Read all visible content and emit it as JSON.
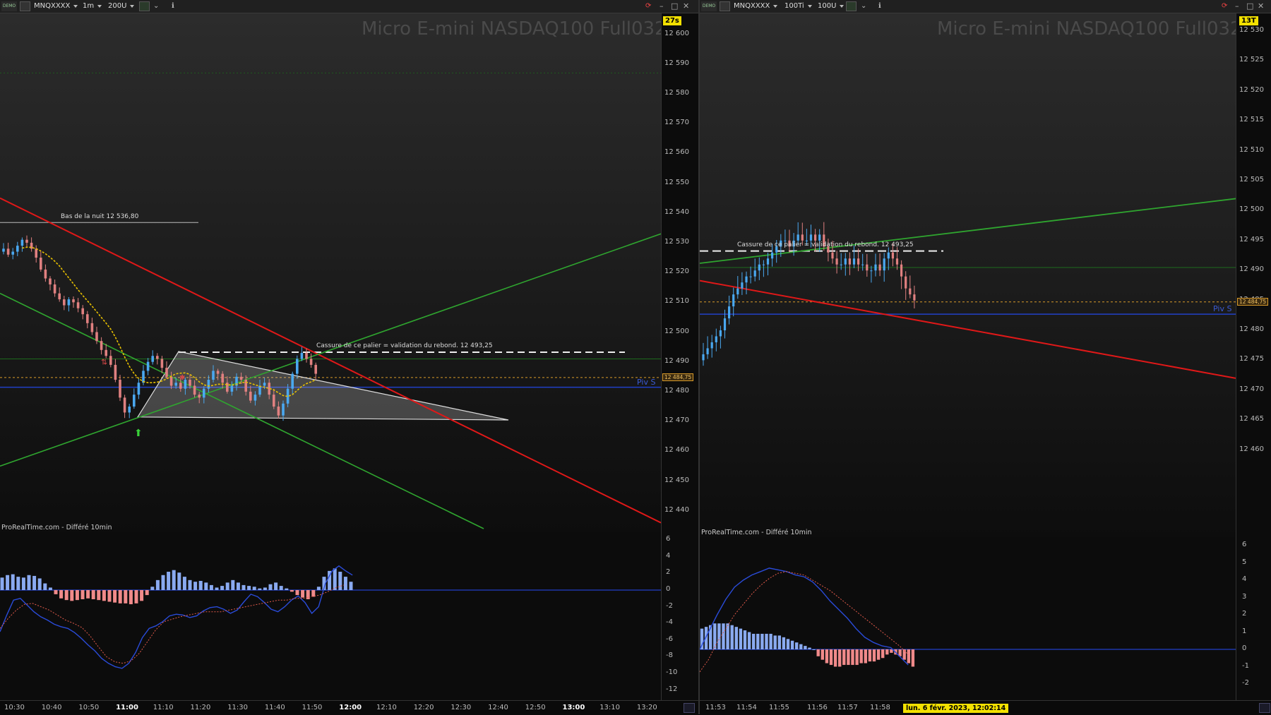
{
  "left": {
    "toolbar": {
      "instrument": "MNQXXXX",
      "period": "1m",
      "units": "200U"
    },
    "countdown": "27s",
    "title": "Micro E-mini NASDAQ100 Full0323",
    "source": "ProRealTime.com - Différé 10min",
    "annotations": {
      "night_low": "Bas de la nuit 12 536,80",
      "breakout": "Cassure de ce palier = validation du rebond. 12 493,25",
      "piv": "Piv S",
      "last_price": "12 484,75"
    },
    "x_labels": [
      {
        "t": "10:30",
        "b": false
      },
      {
        "t": "10:40",
        "b": false
      },
      {
        "t": "10:50",
        "b": false
      },
      {
        "t": "11:00",
        "b": true
      },
      {
        "t": "11:10",
        "b": false
      },
      {
        "t": "11:20",
        "b": false
      },
      {
        "t": "11:30",
        "b": false
      },
      {
        "t": "11:40",
        "b": false
      },
      {
        "t": "11:50",
        "b": false
      },
      {
        "t": "12:00",
        "b": true
      },
      {
        "t": "12:10",
        "b": false
      },
      {
        "t": "12:20",
        "b": false
      },
      {
        "t": "12:30",
        "b": false
      },
      {
        "t": "12:40",
        "b": false
      },
      {
        "t": "12:50",
        "b": false
      },
      {
        "t": "13:00",
        "b": true
      },
      {
        "t": "13:10",
        "b": false
      },
      {
        "t": "13:20",
        "b": false
      }
    ],
    "price_labels": [
      "12 600",
      "12 590",
      "12 580",
      "12 570",
      "12 560",
      "12 550",
      "12 540",
      "12 530",
      "12 520",
      "12 510",
      "12 500",
      "12 490",
      "12 480",
      "12 470",
      "12 460",
      "12 450",
      "12 440"
    ],
    "ind_labels": [
      "6",
      "4",
      "2",
      "0",
      "-2",
      "-4",
      "-6",
      "-8",
      "-10",
      "-12"
    ]
  },
  "right": {
    "toolbar": {
      "instrument": "MNQXXXX",
      "period": "100Ti",
      "units": "100U"
    },
    "countdown": "13T",
    "title": "Micro E-mini NASDAQ100 Full0323",
    "source": "ProRealTime.com - Différé 10min",
    "annotations": {
      "breakout": "Cassure de ce palier = validation du rebond. 12 493,25",
      "piv": "Piv S",
      "last_price": "12 484,75"
    },
    "x_labels": [
      {
        "t": "11:53",
        "b": false
      },
      {
        "t": "11:54",
        "b": false
      },
      {
        "t": "11:55",
        "b": false
      },
      {
        "t": "11:56",
        "b": false
      },
      {
        "t": "11:57",
        "b": false
      },
      {
        "t": "11:58",
        "b": false
      },
      {
        "t": "12:00",
        "b": true
      }
    ],
    "date_tag": "lun. 6 févr. 2023, 12:02:14",
    "price_labels": [
      "12 530",
      "12 525",
      "12 520",
      "12 515",
      "12 510",
      "12 505",
      "12 500",
      "12 495",
      "12 490",
      "12 485",
      "12 480",
      "12 475",
      "12 470",
      "12 465",
      "12 460"
    ],
    "ind_labels": [
      "6",
      "5",
      "4",
      "3",
      "2",
      "1",
      "0",
      "-1",
      "-2"
    ]
  },
  "colors": {
    "up": "#4aa8f0",
    "down": "#e08080",
    "sma": "#e8c000",
    "green": "#2fa52f",
    "red": "#e01818",
    "blue": "#2140c8",
    "hist_up": "#8aaaf0",
    "hist_down": "#f08a8a"
  },
  "chart_data": [
    {
      "type": "candlestick",
      "title": "Micro E-mini NASDAQ100 Full0323",
      "timeframe": "1m",
      "ylim": [
        12435,
        12605
      ],
      "time_range": [
        "10:24",
        "13:24"
      ],
      "close": [
        12528,
        12526,
        12527,
        12529,
        12531,
        12530,
        12528,
        12525,
        12521,
        12518,
        12516,
        12513,
        12511,
        12509,
        12511,
        12510,
        12508,
        12506,
        12503,
        12500,
        12497,
        12494,
        12492,
        12489,
        12484,
        12478,
        12473,
        12475,
        12479,
        12483,
        12487,
        12490,
        12492,
        12491,
        12488,
        12485,
        12482,
        12483,
        12481,
        12484,
        12482,
        12479,
        12478,
        12481,
        12484,
        12487,
        12486,
        12483,
        12480,
        12482,
        12485,
        12484,
        12480,
        12477,
        12479,
        12482,
        12483,
        12479,
        12475,
        12472,
        12476,
        12481,
        12486,
        12491,
        12493,
        12491,
        12489,
        12486
      ],
      "levels": {
        "night_low": 12536.8,
        "breakout": 12493.25,
        "piv_s": 12481.5,
        "last": 12484.75,
        "green_h": 12491
      },
      "indicator": {
        "name": "MACD histogram",
        "ylim": [
          -13,
          7
        ],
        "histogram": [
          1.5,
          1.8,
          1.9,
          1.6,
          1.5,
          1.8,
          1.7,
          1.4,
          0.8,
          0.3,
          -0.5,
          -1,
          -1.2,
          -1.3,
          -1.2,
          -1.1,
          -1,
          -1.1,
          -1.2,
          -1.3,
          -1.4,
          -1.5,
          -1.6,
          -1.6,
          -1.7,
          -1.6,
          -1.3,
          -0.6,
          0.4,
          1.2,
          1.8,
          2.2,
          2.4,
          2.1,
          1.6,
          1.2,
          1,
          1.1,
          0.9,
          0.6,
          0.3,
          0.5,
          0.9,
          1.2,
          0.9,
          0.6,
          0.5,
          0.4,
          0.2,
          0.3,
          0.7,
          0.9,
          0.5,
          0.2,
          -0.2,
          -0.6,
          -0.9,
          -1.1,
          -0.8,
          0.4,
          1.6,
          2.3,
          2.6,
          2.2,
          1.6,
          1.0
        ],
        "macd": [
          -5,
          -3,
          -1.2,
          -1,
          -1.8,
          -2.6,
          -3.2,
          -3.6,
          -4.1,
          -4.4,
          -4.6,
          -5.1,
          -5.8,
          -6.6,
          -7.3,
          -8.2,
          -8.8,
          -9.2,
          -9.4,
          -8.8,
          -7.5,
          -5.7,
          -4.6,
          -4.3,
          -3.8,
          -3.1,
          -2.9,
          -3,
          -3.3,
          -3.1,
          -2.5,
          -2.1,
          -2,
          -2.3,
          -2.8,
          -2.4,
          -1.4,
          -0.5,
          -0.8,
          -1.5,
          -2.3,
          -2.6,
          -2,
          -1.2,
          -0.7,
          -1.5,
          -2.8,
          -2,
          0.8,
          2.3,
          2.9,
          2.3,
          1.8
        ],
        "signal": [
          -4.6,
          -3.4,
          -2.4,
          -1.7,
          -1.6,
          -2,
          -2.4,
          -3,
          -3.6,
          -4,
          -4.5,
          -5.5,
          -6.8,
          -8,
          -8.6,
          -8.8,
          -8.5,
          -7.6,
          -6.2,
          -4.8,
          -3.8,
          -3.5,
          -3.2,
          -3,
          -2.8,
          -2.6,
          -2.6,
          -2.6,
          -2.4,
          -2.2,
          -2,
          -1.8,
          -1.6,
          -1.4,
          -1.2,
          -1.2,
          -1,
          -1,
          -0.8,
          -0.6,
          -0.2,
          0.3,
          0.6
        ]
      }
    },
    {
      "type": "candlestick",
      "title": "Micro E-mini NASDAQ100 Full0323",
      "timeframe": "100 ticks",
      "ylim": [
        12455,
        12532
      ],
      "time_range": [
        "11:52:40",
        "12:02:14"
      ],
      "close": [
        12476,
        12477,
        12478,
        12479,
        12480,
        12482,
        12484,
        12486,
        12487,
        12488,
        12489,
        12489,
        12490,
        12491,
        12491,
        12492,
        12493,
        12494,
        12495,
        12495,
        12494,
        12495,
        12496,
        12495,
        12495,
        12496,
        12495,
        12496,
        12494,
        12493,
        12492,
        12491,
        12491,
        12492,
        12491,
        12492,
        12491,
        12491,
        12490,
        12490,
        12491,
        12490,
        12492,
        12493,
        12492,
        12491,
        12489,
        12487,
        12486,
        12485
      ],
      "levels": {
        "breakout": 12493.25,
        "piv_s": 12482.7,
        "last": 12484.75,
        "green_h": 12490.5
      },
      "indicator": {
        "name": "MACD histogram",
        "ylim": [
          -2.7,
          6.4
        ],
        "histogram": [
          1.2,
          1.3,
          1.4,
          1.5,
          1.5,
          1.5,
          1.5,
          1.4,
          1.3,
          1.2,
          1.1,
          1,
          0.9,
          0.9,
          0.9,
          0.9,
          0.9,
          0.8,
          0.8,
          0.7,
          0.6,
          0.5,
          0.4,
          0.3,
          0.2,
          0.1,
          0,
          -0.4,
          -0.6,
          -0.8,
          -0.9,
          -1,
          -1,
          -0.9,
          -0.9,
          -0.9,
          -0.9,
          -0.8,
          -0.8,
          -0.7,
          -0.7,
          -0.6,
          -0.5,
          -0.3,
          -0.2,
          -0.3,
          -0.4,
          -0.6,
          -0.8,
          -1
        ],
        "macd": [
          0,
          1,
          2,
          2.9,
          3.6,
          4,
          4.3,
          4.5,
          4.7,
          4.6,
          4.5,
          4.3,
          4.2,
          3.9,
          3.4,
          2.8,
          2.3,
          1.8,
          1.2,
          0.7,
          0.4,
          0.2,
          0.1,
          -0.4,
          -0.9
        ],
        "signal": [
          -1.3,
          -0.6,
          0.4,
          1.2,
          2,
          2.6,
          3.2,
          3.7,
          4.1,
          4.4,
          4.5,
          4.4,
          4.3,
          4,
          3.7,
          3.4,
          3,
          2.6,
          2.2,
          1.8,
          1.4,
          1,
          0.6,
          0.2,
          -0.3
        ]
      }
    }
  ]
}
